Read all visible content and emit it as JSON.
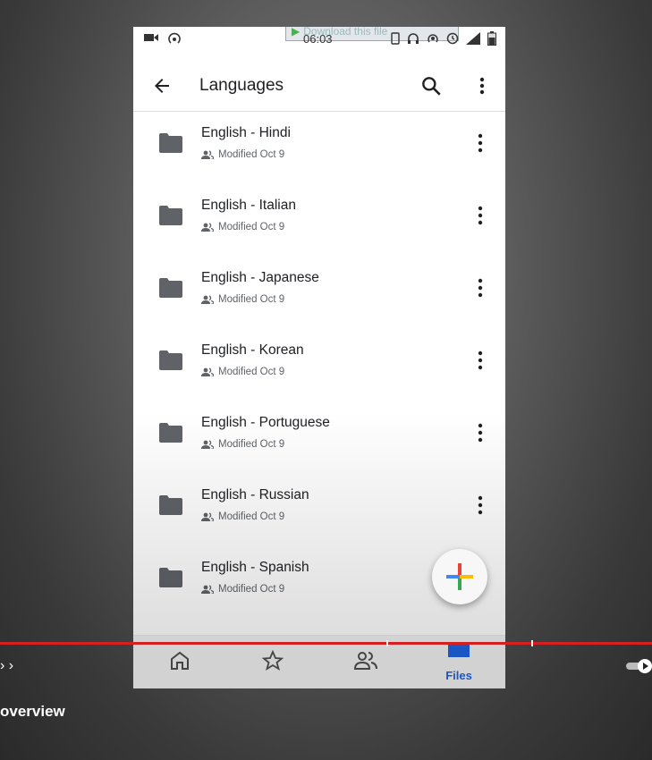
{
  "status_bar": {
    "time": "06:03",
    "overlay_text": "Download this file"
  },
  "app_bar": {
    "title": "Languages"
  },
  "files": [
    {
      "name": "English - Hindi",
      "meta": "Modified Oct 9"
    },
    {
      "name": "English - Italian",
      "meta": "Modified Oct 9"
    },
    {
      "name": "English - Japanese",
      "meta": "Modified Oct 9"
    },
    {
      "name": "English - Korean",
      "meta": "Modified Oct 9"
    },
    {
      "name": "English - Portuguese",
      "meta": "Modified Oct 9"
    },
    {
      "name": "English - Russian",
      "meta": "Modified Oct 9"
    },
    {
      "name": "English - Spanish",
      "meta": "Modified Oct 9"
    }
  ],
  "bottom_nav": {
    "items": [
      {
        "icon": "home-icon"
      },
      {
        "icon": "star-icon"
      },
      {
        "icon": "shared-icon"
      },
      {
        "icon": "files-icon",
        "label": "Files"
      }
    ]
  },
  "player": {
    "caption": "overview",
    "chevron": "› ›"
  },
  "colors": {
    "accent": "#1a56c4",
    "progress": "#d42020",
    "folder": "#5f6368"
  }
}
